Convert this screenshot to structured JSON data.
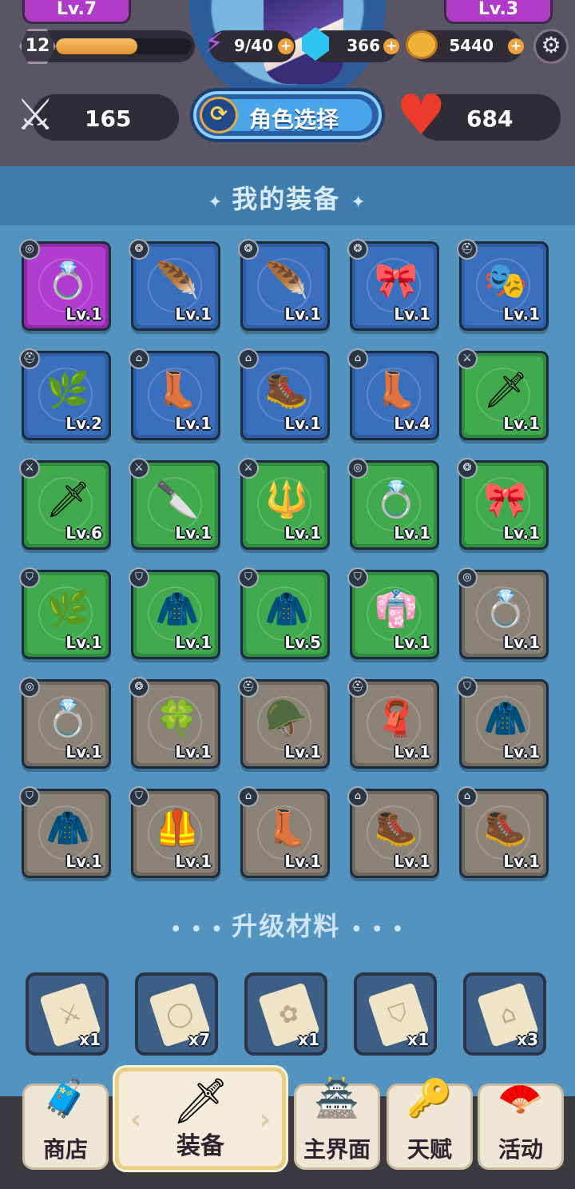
{
  "header": {
    "left_tab_level": "Lv.7",
    "right_tab_level": "Lv.3",
    "player_level": "12",
    "xp_fraction": 0.6,
    "energy": "9/40",
    "gems": "366",
    "coins": "5440",
    "attack": "165",
    "role_select_label": "角色选择",
    "hp": "684"
  },
  "equipment_section": {
    "title": "我的装备"
  },
  "items": [
    {
      "quality": "purple",
      "type": "ring",
      "art": "💍",
      "level": "Lv.1"
    },
    {
      "quality": "blue",
      "type": "amulet",
      "art": "🪶",
      "level": "Lv.1"
    },
    {
      "quality": "blue",
      "type": "amulet",
      "art": "🪶",
      "level": "Lv.1"
    },
    {
      "quality": "blue",
      "type": "amulet",
      "art": "🎀",
      "level": "Lv.1"
    },
    {
      "quality": "blue",
      "type": "helmet",
      "art": "🎭",
      "level": "Lv.1"
    },
    {
      "quality": "blue",
      "type": "helmet",
      "art": "🌿",
      "level": "Lv.2"
    },
    {
      "quality": "blue",
      "type": "boots",
      "art": "👢",
      "level": "Lv.1"
    },
    {
      "quality": "blue",
      "type": "boots",
      "art": "🥾",
      "level": "Lv.1"
    },
    {
      "quality": "blue",
      "type": "boots",
      "art": "👢",
      "level": "Lv.4"
    },
    {
      "quality": "green",
      "type": "weapon",
      "art": "🗡",
      "level": "Lv.1"
    },
    {
      "quality": "green",
      "type": "weapon",
      "art": "🗡",
      "level": "Lv.6"
    },
    {
      "quality": "green",
      "type": "weapon",
      "art": "🔪",
      "level": "Lv.1"
    },
    {
      "quality": "green",
      "type": "weapon",
      "art": "🔱",
      "level": "Lv.1"
    },
    {
      "quality": "green",
      "type": "ring",
      "art": "💍",
      "level": "Lv.1"
    },
    {
      "quality": "green",
      "type": "amulet",
      "art": "🎀",
      "level": "Lv.1"
    },
    {
      "quality": "green",
      "type": "armor",
      "art": "🌿",
      "level": "Lv.1"
    },
    {
      "quality": "green",
      "type": "armor",
      "art": "🧥",
      "level": "Lv.1"
    },
    {
      "quality": "green",
      "type": "armor",
      "art": "🧥",
      "level": "Lv.5"
    },
    {
      "quality": "green",
      "type": "armor",
      "art": "👘",
      "level": "Lv.1"
    },
    {
      "quality": "gray",
      "type": "ring",
      "art": "💍",
      "level": "Lv.1"
    },
    {
      "quality": "gray",
      "type": "ring",
      "art": "💍",
      "level": "Lv.1"
    },
    {
      "quality": "gray",
      "type": "amulet",
      "art": "🍀",
      "level": "Lv.1"
    },
    {
      "quality": "gray",
      "type": "helmet",
      "art": "🪖",
      "level": "Lv.1"
    },
    {
      "quality": "gray",
      "type": "helmet",
      "art": "🧣",
      "level": "Lv.1"
    },
    {
      "quality": "gray",
      "type": "armor",
      "art": "🧥",
      "level": "Lv.1"
    },
    {
      "quality": "gray",
      "type": "armor",
      "art": "🧥",
      "level": "Lv.1"
    },
    {
      "quality": "gray",
      "type": "armor",
      "art": "🦺",
      "level": "Lv.1"
    },
    {
      "quality": "gray",
      "type": "boots",
      "art": "👢",
      "level": "Lv.1"
    },
    {
      "quality": "gray",
      "type": "boots",
      "art": "🥾",
      "level": "Lv.1"
    },
    {
      "quality": "gray",
      "type": "boots",
      "art": "🥾",
      "level": "Lv.1"
    }
  ],
  "materials_section": {
    "title": "升级材料"
  },
  "materials": [
    {
      "icon": "sword-scroll",
      "glyph": "⚔",
      "qty": "x1"
    },
    {
      "icon": "ring-scroll",
      "glyph": "◯",
      "qty": "x7"
    },
    {
      "icon": "amulet-scroll",
      "glyph": "✿",
      "qty": "x1"
    },
    {
      "icon": "armor-scroll",
      "glyph": "⛉",
      "qty": "x1"
    },
    {
      "icon": "boots-scroll",
      "glyph": "⌂",
      "qty": "x3"
    }
  ],
  "nav": [
    {
      "label": "商店",
      "icon": "treasure-chest-icon",
      "glyph": "🧳",
      "active": false
    },
    {
      "label": "装备",
      "icon": "sword-shield-icon",
      "glyph": "🗡",
      "active": true
    },
    {
      "label": "主界面",
      "icon": "castle-tower-icon",
      "glyph": "🏯",
      "active": false
    },
    {
      "label": "天赋",
      "icon": "talent-key-icon",
      "glyph": "🔑",
      "active": false
    },
    {
      "label": "活动",
      "icon": "event-fan-icon",
      "glyph": "🪭",
      "active": false
    }
  ],
  "colors": {
    "purple": "#b03cd0",
    "blue": "#3a6fbd",
    "green": "#41aa4c",
    "gray": "#8a8378",
    "background": "#5393c0"
  }
}
